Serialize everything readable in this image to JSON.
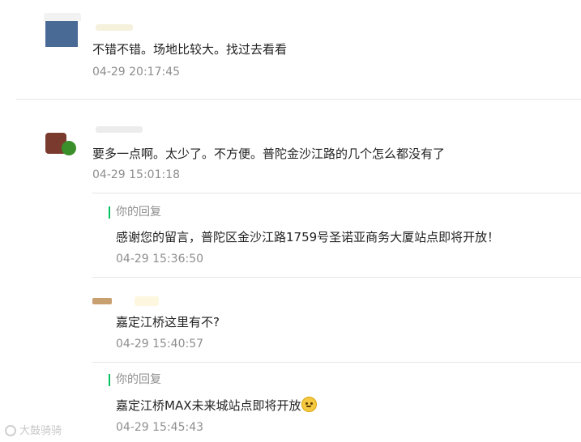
{
  "comments": [
    {
      "text": "不错不错。场地比较大。找过去看看",
      "time": "04-29 20:17:45"
    },
    {
      "text": "要多一点啊。太少了。不方便。普陀金沙江路的几个怎么都没有了",
      "time": "04-29 15:01:18",
      "replies": [
        {
          "label": "你的回复",
          "text": "感谢您的留言，普陀区金沙江路1759号圣诺亚商务大厦站点即将开放！",
          "time": "04-29 15:36:50"
        },
        {
          "text": "嘉定江桥这里有不?",
          "time": "04-29 15:40:57"
        },
        {
          "label": "你的回复",
          "text": "嘉定江桥MAX未来城站点即将开放",
          "time": "04-29 15:45:43",
          "emoji": "smile-emoji"
        }
      ]
    }
  ],
  "watermark": "大鼓骑骑",
  "colors": {
    "accent": "#07c160",
    "muted": "#8e8e8e",
    "text": "#222222"
  }
}
